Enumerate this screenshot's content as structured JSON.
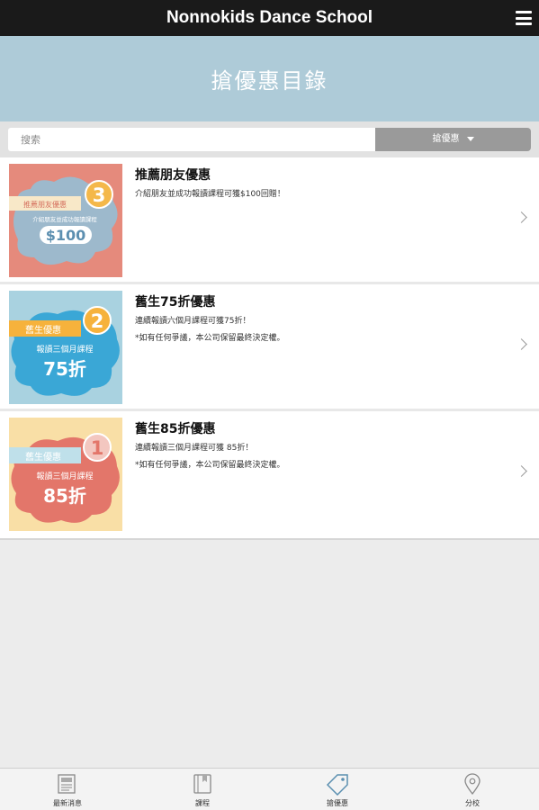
{
  "header": {
    "title": "Nonnokids Dance School",
    "menu_icon": "hamburger-menu-icon"
  },
  "page": {
    "heading": "搶優惠目錄"
  },
  "search": {
    "placeholder": "搜索",
    "filter_label": "搶優惠"
  },
  "colors": {
    "topbar": "#1a1a1a",
    "hero": "#aecbd8",
    "filter": "#9a9a9a",
    "active_tab": "#5a8fb0"
  },
  "items": [
    {
      "title": "推薦朋友優惠",
      "desc": "介紹朋友並成功報讀課程可獲$100回贈！",
      "note": "",
      "thumb": {
        "bg": "#e58a7c",
        "badge": "3",
        "tag": "推薦朋友優惠",
        "line1": "介紹朋友並成功報讀課程",
        "big": "$100",
        "cloud": "#9db9cc"
      }
    },
    {
      "title": "舊生75折優惠",
      "desc": "連續報讀六個月課程可獲75折！",
      "note": "*如有任何爭議，本公司保留最終決定權。",
      "thumb": {
        "bg": "#a9d2e0",
        "badge": "2",
        "tag": "舊生優惠",
        "line1": "報讀三個月課程",
        "big": "75折",
        "cloud": "#3aa7d6"
      }
    },
    {
      "title": "舊生85折優惠",
      "desc": "連續報讀三個月課程可獲 85折！",
      "note": "*如有任何爭議，本公司保留最終決定權。",
      "thumb": {
        "bg": "#f9dfa6",
        "badge": "1",
        "tag": "舊生優惠",
        "line1": "報讀三個月課程",
        "big": "85折",
        "cloud": "#e3766a"
      }
    }
  ],
  "tabs": [
    {
      "label": "最新消息",
      "icon": "news-icon",
      "active": false
    },
    {
      "label": "課程",
      "icon": "book-icon",
      "active": false
    },
    {
      "label": "搶優惠",
      "icon": "tag-icon",
      "active": true
    },
    {
      "label": "分校",
      "icon": "location-pin-icon",
      "active": false
    }
  ]
}
